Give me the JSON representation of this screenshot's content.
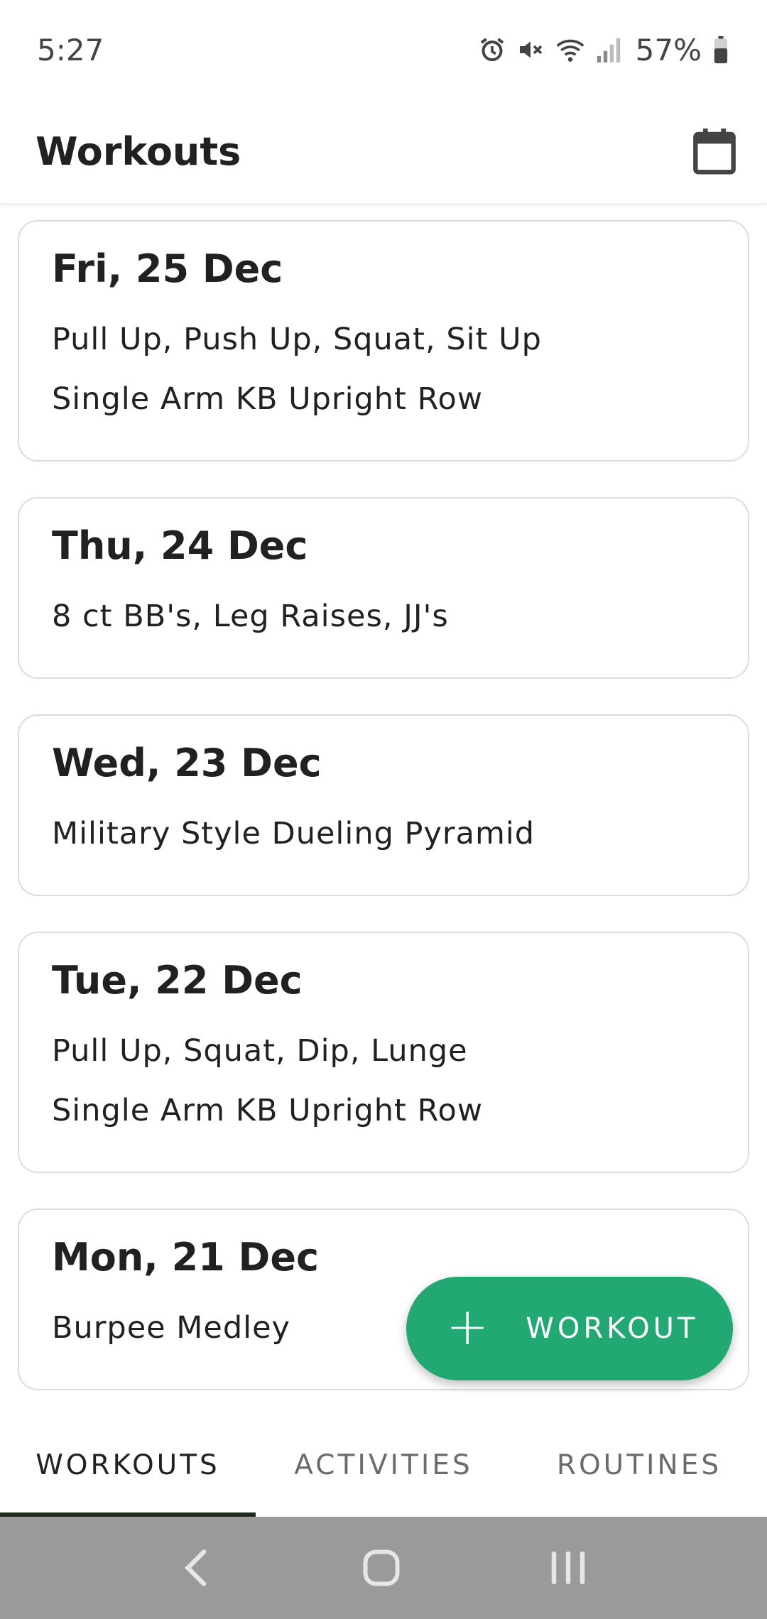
{
  "status": {
    "time": "5:27",
    "battery": "57%",
    "icons": [
      "alarm-icon",
      "mute-icon",
      "wifi-icon",
      "signal-icon",
      "battery-icon"
    ]
  },
  "app_bar": {
    "title": "Workouts",
    "calendar_icon": "calendar-icon"
  },
  "workouts": [
    {
      "date": "Fri, 25 Dec",
      "lines": [
        "Pull Up, Push Up, Squat, Sit Up",
        "Single Arm KB Upright Row"
      ]
    },
    {
      "date": "Thu, 24 Dec",
      "lines": [
        "8 ct BB's, Leg Raises, JJ's"
      ]
    },
    {
      "date": "Wed, 23 Dec",
      "lines": [
        "Military Style Dueling Pyramid"
      ]
    },
    {
      "date": "Tue, 22 Dec",
      "lines": [
        "Pull Up, Squat, Dip, Lunge",
        "Single Arm KB Upright Row"
      ]
    },
    {
      "date": "Mon, 21 Dec",
      "lines": [
        "Burpee Medley"
      ]
    }
  ],
  "fab": {
    "icon": "plus-icon",
    "label": "WORKOUT"
  },
  "tabs": [
    {
      "label": "WORKOUTS",
      "active": true
    },
    {
      "label": "ACTIVITIES",
      "active": false
    },
    {
      "label": "ROUTINES",
      "active": false
    }
  ],
  "colors": {
    "accent": "#21a873",
    "nav_bar": "#9a9a9a"
  }
}
